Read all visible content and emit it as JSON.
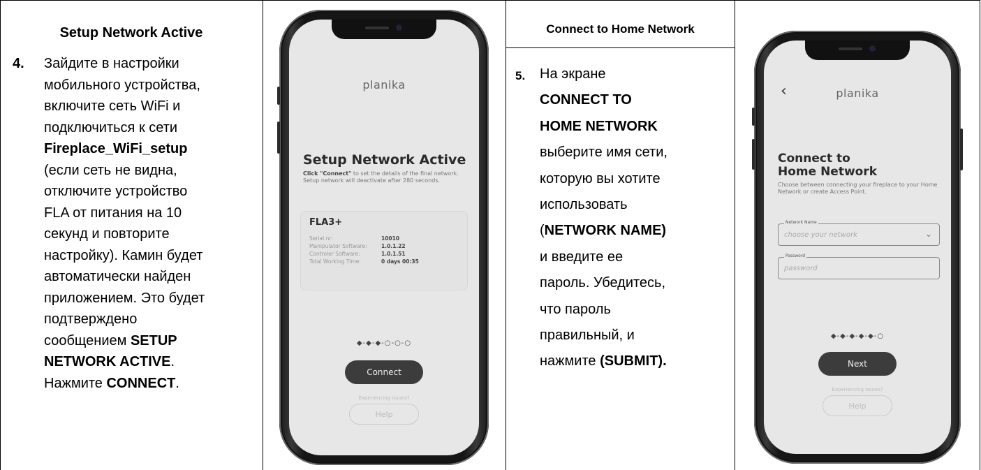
{
  "col1": {
    "header": "Setup Network Active",
    "step": "4.",
    "lines": [
      [
        {
          "t": "Зайдите в настройки"
        }
      ],
      [
        {
          "t": "мобильного устройства,"
        }
      ],
      [
        {
          "t": "включите сеть WiFi и"
        }
      ],
      [
        {
          "t": "подключиться к сети"
        }
      ],
      [
        {
          "t": "Fireplace_WiFi_setup",
          "b": true
        }
      ],
      [
        {
          "t": "(если сеть не видна,"
        }
      ],
      [
        {
          "t": "отключите устройство"
        }
      ],
      [
        {
          "t": "FLA от питания на 10"
        }
      ],
      [
        {
          "t": "секунд и повторите"
        }
      ],
      [
        {
          "t": "настройку). Камин будет"
        }
      ],
      [
        {
          "t": "автоматически найден"
        }
      ],
      [
        {
          "t": "приложением. Это будет"
        }
      ],
      [
        {
          "t": "подтверждено"
        }
      ],
      [
        {
          "t": "сообщением "
        },
        {
          "t": "SETUP",
          "b": true
        }
      ],
      [
        {
          "t": "NETWORK ACTIVE",
          "b": true
        },
        {
          "t": "."
        }
      ],
      [
        {
          "t": "Нажмите "
        },
        {
          "t": "CONNECT",
          "b": true
        },
        {
          "t": "."
        }
      ]
    ]
  },
  "col3": {
    "header": "Connect to Home Network",
    "step": "5.",
    "lines": [
      [
        {
          "t": "На экране"
        }
      ],
      [
        {
          "t": "CONNECT TO",
          "b": true
        }
      ],
      [
        {
          "t": "HOME NETWORK",
          "b": true
        }
      ],
      [
        {
          "t": "выберите имя сети,"
        }
      ],
      [
        {
          "t": "которую вы хотите"
        }
      ],
      [
        {
          "t": "использовать"
        }
      ],
      [
        {
          "t": "("
        },
        {
          "t": "NETWORK NAME)",
          "b": true
        }
      ],
      [
        {
          "t": "и введите ее"
        }
      ],
      [
        {
          "t": "пароль. Убедитесь,"
        }
      ],
      [
        {
          "t": "что пароль"
        }
      ],
      [
        {
          "t": "правильный, и"
        }
      ],
      [
        {
          "t": "нажмите "
        },
        {
          "t": "(SUBMIT).",
          "b": true
        }
      ]
    ]
  },
  "phone1": {
    "logo": "planika",
    "title": "Setup Network Active",
    "desc_bold": "Click \"Connect\"",
    "desc_rest": " to set the details of the final network. Setup network will deactivate after 280 seconds.",
    "device": {
      "name": "FLA3+",
      "rows": [
        {
          "label": "Serial nr:",
          "value": "10010"
        },
        {
          "label": "Manipulator Software:",
          "value": "1.0.1.22"
        },
        {
          "label": "Controler Software:",
          "value": "1.0.1.51"
        },
        {
          "label": "Total Working Time:",
          "value": "0 days  00:35"
        }
      ]
    },
    "dots": "◆-◆-◆-○-○-○",
    "button": "Connect",
    "issues": "Experiencing issues?",
    "help": "Help"
  },
  "phone2": {
    "logo": "planika",
    "back": "‹",
    "title_line1": "Connect to",
    "title_line2": "Home Network",
    "desc": "Choose between connecting your fireplace to your Home Network or create Access Point.",
    "network_label": "Network Name",
    "network_placeholder": "choose your network",
    "password_label": "Password",
    "password_placeholder": "password",
    "dots": "◆-◆-◆-◆-◆-○",
    "button": "Next",
    "issues": "Experiencing issues?",
    "help": "Help"
  }
}
